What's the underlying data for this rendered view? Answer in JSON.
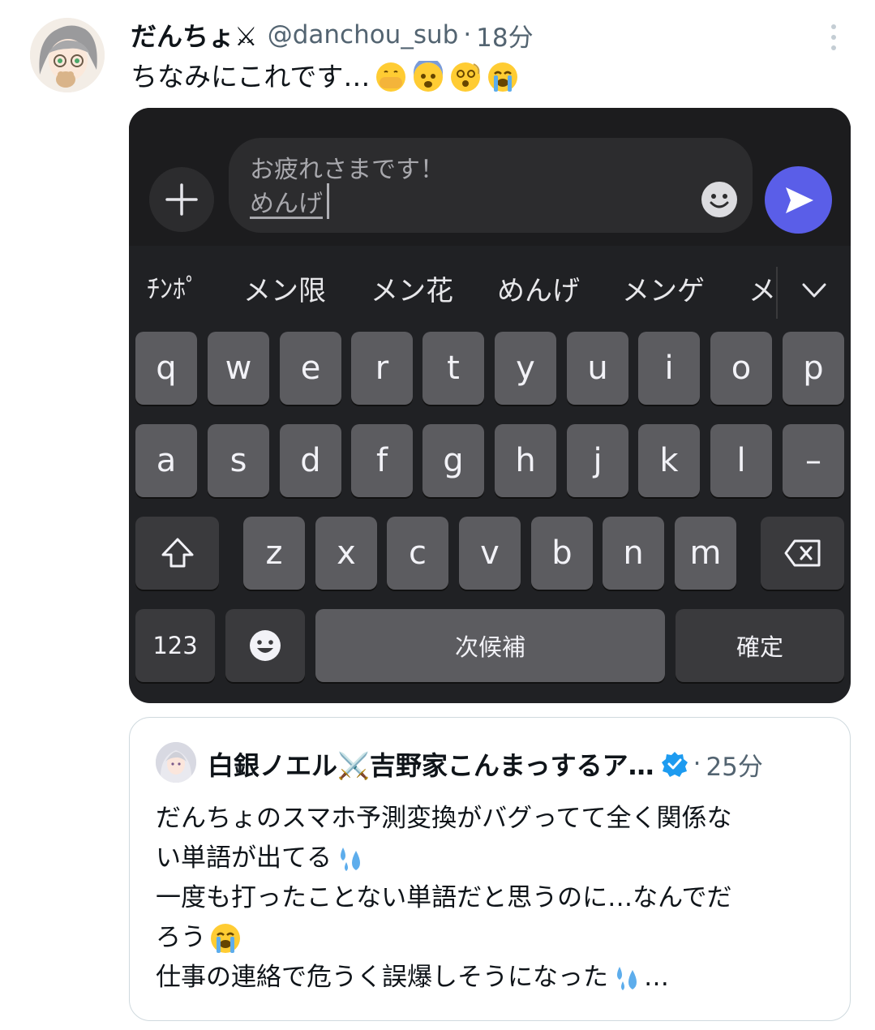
{
  "tweet": {
    "display_name": "だんちょ⚔",
    "handle": "@danchou_sub",
    "separator": "·",
    "time": "18分",
    "text": "ちなみにこれです…",
    "emojis": [
      "face-with-hand-over-mouth-emoji",
      "fearful-face-emoji",
      "dizzy-face-emoji",
      "loudly-crying-face-emoji"
    ]
  },
  "media": {
    "message_line1": "お疲れさまです！",
    "message_line2": "めんげ",
    "suggestions": [
      "ﾁﾝﾎﾟ",
      "メン限",
      "メン花",
      "めんげ",
      "メンゲ",
      "メ"
    ],
    "keyboard": {
      "row1": [
        "q",
        "w",
        "e",
        "r",
        "t",
        "y",
        "u",
        "i",
        "o",
        "p"
      ],
      "row2": [
        "a",
        "s",
        "d",
        "f",
        "g",
        "h",
        "j",
        "k",
        "l",
        "–"
      ],
      "row3": [
        "z",
        "x",
        "c",
        "v",
        "b",
        "n",
        "m"
      ],
      "numbers_key": "123",
      "space_key": "次候補",
      "confirm_key": "確定"
    },
    "colors": {
      "send_button": "#5a5ee8",
      "keyboard_bg": "#202124",
      "key": "#5c5c60"
    }
  },
  "quote": {
    "display_name": "白銀ノエル⚔️吉野家こんまっするア…",
    "separator": "·",
    "time": "25分",
    "line1": "だんちょのスマホ予測変換がバグってて全く関係な",
    "line2": "い単語が出てる",
    "line3": "一度も打ったことない単語だと思うのに…なんでだ",
    "line4": "ろう",
    "line5": "仕事の連絡で危うく誤爆しそうになった",
    "line5_suffix": "…",
    "colors": {
      "verified": "#1d9bf0",
      "muted": "#536471"
    }
  }
}
